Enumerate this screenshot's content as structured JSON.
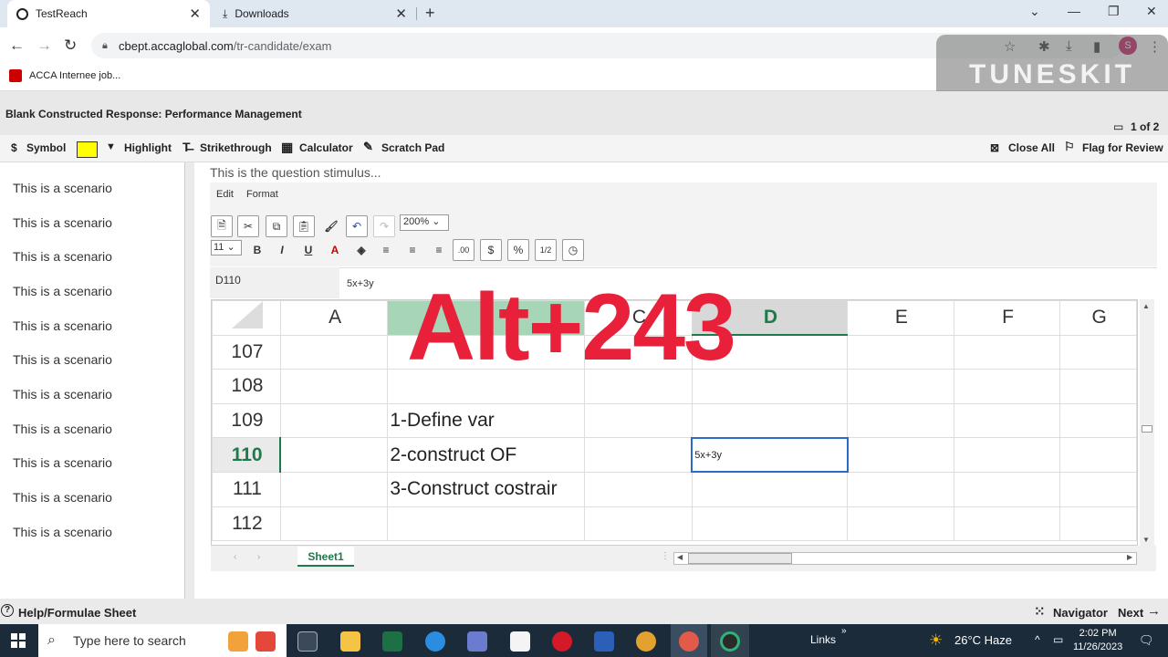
{
  "browser": {
    "tabs": [
      {
        "label": "TestReach",
        "icon": "testreach-icon"
      },
      {
        "label": "Downloads",
        "icon": "download-icon"
      }
    ],
    "url_host": "cbept.accaglobal.com",
    "url_path": "/tr-candidate/exam",
    "bookmark": "ACCA Internee job...",
    "profile_initial": "S"
  },
  "watermark": "TUNESKIT",
  "exam": {
    "title": "Blank Constructed Response: Performance Management",
    "page": "1 of 2",
    "tools": {
      "symbol": "Symbol",
      "highlight": "Highlight",
      "strikethrough": "Strikethrough",
      "calculator": "Calculator",
      "scratch_pad": "Scratch Pad",
      "close_all": "Close All",
      "flag": "Flag for Review"
    },
    "highlight_color": "#ffff00",
    "scenarios": [
      "This is a scenario",
      "This is a scenario",
      "This is a scenario",
      "This is a scenario",
      "This is a scenario",
      "This is a scenario",
      "This is a scenario",
      "This is a scenario",
      "This is a scenario",
      "This is a scenario",
      "This is a scenario"
    ],
    "stimulus": "This is the question stimulus...",
    "help": "Help/Formulae Sheet",
    "navigator": "Navigator",
    "next": "Next"
  },
  "spreadsheet": {
    "menu": [
      "Edit",
      "Format"
    ],
    "zoom": "200%",
    "font_size": "11",
    "ribbon_text": {
      "bold": "B",
      "italic": "I",
      "underline": "U",
      "font_color": "A",
      "decimals": ".00",
      "percent": "%",
      "fraction": "1/2"
    },
    "name_box": "D110",
    "formula": "5x+3y",
    "columns": [
      "A",
      "B",
      "C",
      "D",
      "E",
      "F",
      "G"
    ],
    "rows": [
      {
        "num": "107",
        "b": ""
      },
      {
        "num": "108",
        "b": ""
      },
      {
        "num": "109",
        "b": "1-Define var"
      },
      {
        "num": "110",
        "b": "2-construct OF"
      },
      {
        "num": "111",
        "b": "3-Construct costrair"
      },
      {
        "num": "112",
        "b": ""
      }
    ],
    "selected_value": "5x+3y",
    "sheet": "Sheet1",
    "accent": "#1e7a4a"
  },
  "overlay_text": "Alt+243",
  "taskbar": {
    "search_placeholder": "Type here to search",
    "links": "Links",
    "weather": "26°C  Haze",
    "time": "2:02 PM",
    "date": "11/26/2023"
  }
}
